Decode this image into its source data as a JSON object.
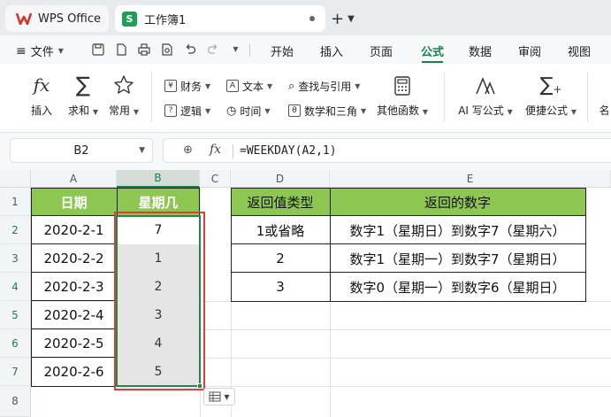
{
  "tabs": [
    {
      "label": "WPS Office"
    },
    {
      "label": "工作簿1",
      "logo": "S"
    }
  ],
  "menu": {
    "file_label": "文件",
    "items": [
      "开始",
      "插入",
      "页面",
      "公式",
      "数据",
      "审阅",
      "视图"
    ],
    "active": "公式"
  },
  "ribbon": {
    "insert_label": "插入",
    "sum_label": "求和",
    "common_label": "常用",
    "finance_label": "财务",
    "text_label": "文本",
    "lookup_label": "查找与引用",
    "logic_label": "逻辑",
    "time_label": "时间",
    "math_label": "数学和三角",
    "other_label": "其他函数",
    "ai_label": "AI 写公式",
    "quick_label": "便捷公式",
    "cut_label": "名"
  },
  "formula_bar": {
    "cell_ref": "B2",
    "fx_symbol": "fx",
    "formula": "=WEEKDAY(A2,1)"
  },
  "columns": [
    "A",
    "B",
    "C",
    "D",
    "E"
  ],
  "rows": [
    "1",
    "2",
    "3",
    "4",
    "5",
    "6",
    "7",
    "8"
  ],
  "sheet": {
    "a_header": "日期",
    "b_header": "星期几",
    "dates": [
      "2020-2-1",
      "2020-2-2",
      "2020-2-3",
      "2020-2-4",
      "2020-2-5",
      "2020-2-6"
    ],
    "weekdays": [
      "7",
      "1",
      "2",
      "3",
      "4",
      "5"
    ],
    "d_header": "返回值类型",
    "e_header": "返回的数字",
    "types": [
      "1或省略",
      "2",
      "3"
    ],
    "results": [
      "数字1（星期日）到数字7（星期六）",
      "数字1（星期一）到数字7（星期日）",
      "数字0（星期一）到数字6（星期日）"
    ]
  },
  "colors": {
    "accent": "#17834a",
    "header_fill": "#8dc752",
    "highlight": "#e03b3b",
    "selection_fill": "#e5e5e5"
  }
}
